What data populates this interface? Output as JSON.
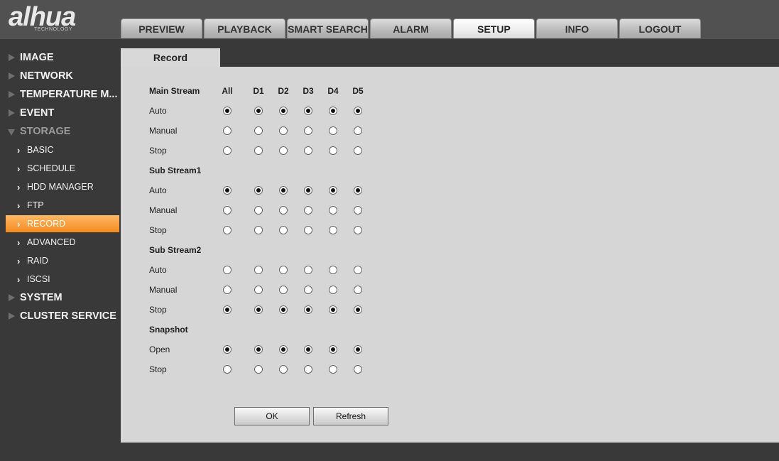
{
  "logo": {
    "brand": "alhua",
    "tagline": "TECHNOLOGY"
  },
  "topnav": {
    "tabs": [
      {
        "label": "PREVIEW"
      },
      {
        "label": "PLAYBACK"
      },
      {
        "label": "SMART SEARCH"
      },
      {
        "label": "ALARM"
      },
      {
        "label": "SETUP",
        "active": true
      },
      {
        "label": "INFO"
      },
      {
        "label": "LOGOUT"
      }
    ]
  },
  "sidebar": {
    "items": [
      {
        "label": "IMAGE"
      },
      {
        "label": "NETWORK"
      },
      {
        "label": "TEMPERATURE M..."
      },
      {
        "label": "EVENT"
      },
      {
        "label": "STORAGE",
        "expanded": true
      },
      {
        "label": "SYSTEM"
      },
      {
        "label": "CLUSTER SERVICE"
      }
    ],
    "storage_children": [
      {
        "label": "BASIC"
      },
      {
        "label": "SCHEDULE"
      },
      {
        "label": "HDD MANAGER"
      },
      {
        "label": "FTP"
      },
      {
        "label": "RECORD",
        "active": true
      },
      {
        "label": "ADVANCED"
      },
      {
        "label": "RAID"
      },
      {
        "label": "ISCSI"
      }
    ]
  },
  "page": {
    "tab_title": "Record"
  },
  "record": {
    "columns": [
      "All",
      "D1",
      "D2",
      "D3",
      "D4",
      "D5"
    ],
    "sections": [
      {
        "title": "Main Stream",
        "rows": [
          {
            "label": "Auto",
            "selected": true
          },
          {
            "label": "Manual",
            "selected": false
          },
          {
            "label": "Stop",
            "selected": false
          }
        ]
      },
      {
        "title": "Sub Stream1",
        "rows": [
          {
            "label": "Auto",
            "selected": true
          },
          {
            "label": "Manual",
            "selected": false
          },
          {
            "label": "Stop",
            "selected": false
          }
        ]
      },
      {
        "title": "Sub Stream2",
        "rows": [
          {
            "label": "Auto",
            "selected": false
          },
          {
            "label": "Manual",
            "selected": false
          },
          {
            "label": "Stop",
            "selected": true
          }
        ]
      },
      {
        "title": "Snapshot",
        "rows": [
          {
            "label": "Open",
            "selected": true
          },
          {
            "label": "Stop",
            "selected": false
          }
        ]
      }
    ],
    "buttons": {
      "ok": "OK",
      "refresh": "Refresh"
    }
  }
}
